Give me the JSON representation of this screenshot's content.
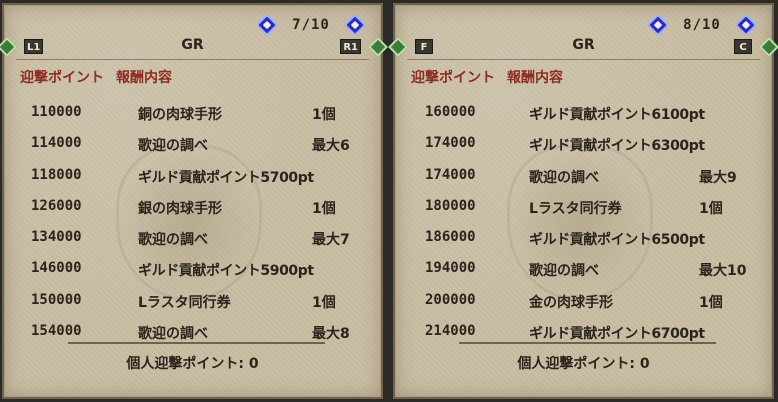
{
  "left_panel": {
    "page": "7/10",
    "rank": "GR",
    "left_button": "L1",
    "right_button": "R1",
    "header_points": "迎撃ポイント",
    "header_reward": "報酬内容",
    "rows": [
      {
        "points": "110000",
        "reward": "銅の肉球手形",
        "qty": "1個"
      },
      {
        "points": "114000",
        "reward": "歌迎の調べ",
        "qty": "最大6"
      },
      {
        "points": "118000",
        "reward": "ギルド貢献ポイント5700pt",
        "qty": ""
      },
      {
        "points": "126000",
        "reward": "銀の肉球手形",
        "qty": "1個"
      },
      {
        "points": "134000",
        "reward": "歌迎の調べ",
        "qty": "最大7"
      },
      {
        "points": "146000",
        "reward": "ギルド貢献ポイント5900pt",
        "qty": ""
      },
      {
        "points": "150000",
        "reward": "Lラスタ同行券",
        "qty": "1個"
      },
      {
        "points": "154000",
        "reward": "歌迎の調べ",
        "qty": "最大8"
      }
    ],
    "footer": "個人迎撃ポイント: 0"
  },
  "right_panel": {
    "page": "8/10",
    "rank": "GR",
    "left_button": "F",
    "right_button": "C",
    "header_points": "迎撃ポイント",
    "header_reward": "報酬内容",
    "rows": [
      {
        "points": "160000",
        "reward": "ギルド貢献ポイント6100pt",
        "qty": ""
      },
      {
        "points": "174000",
        "reward": "ギルド貢献ポイント6300pt",
        "qty": ""
      },
      {
        "points": "174000",
        "reward": "歌迎の調べ",
        "qty": "最大9"
      },
      {
        "points": "180000",
        "reward": "Lラスタ同行券",
        "qty": "1個"
      },
      {
        "points": "186000",
        "reward": "ギルド貢献ポイント6500pt",
        "qty": ""
      },
      {
        "points": "194000",
        "reward": "歌迎の調べ",
        "qty": "最大10"
      },
      {
        "points": "200000",
        "reward": "金の肉球手形",
        "qty": "1個"
      },
      {
        "points": "214000",
        "reward": "ギルド貢献ポイント6700pt",
        "qty": ""
      }
    ],
    "footer": "個人迎撃ポイント: 0"
  }
}
